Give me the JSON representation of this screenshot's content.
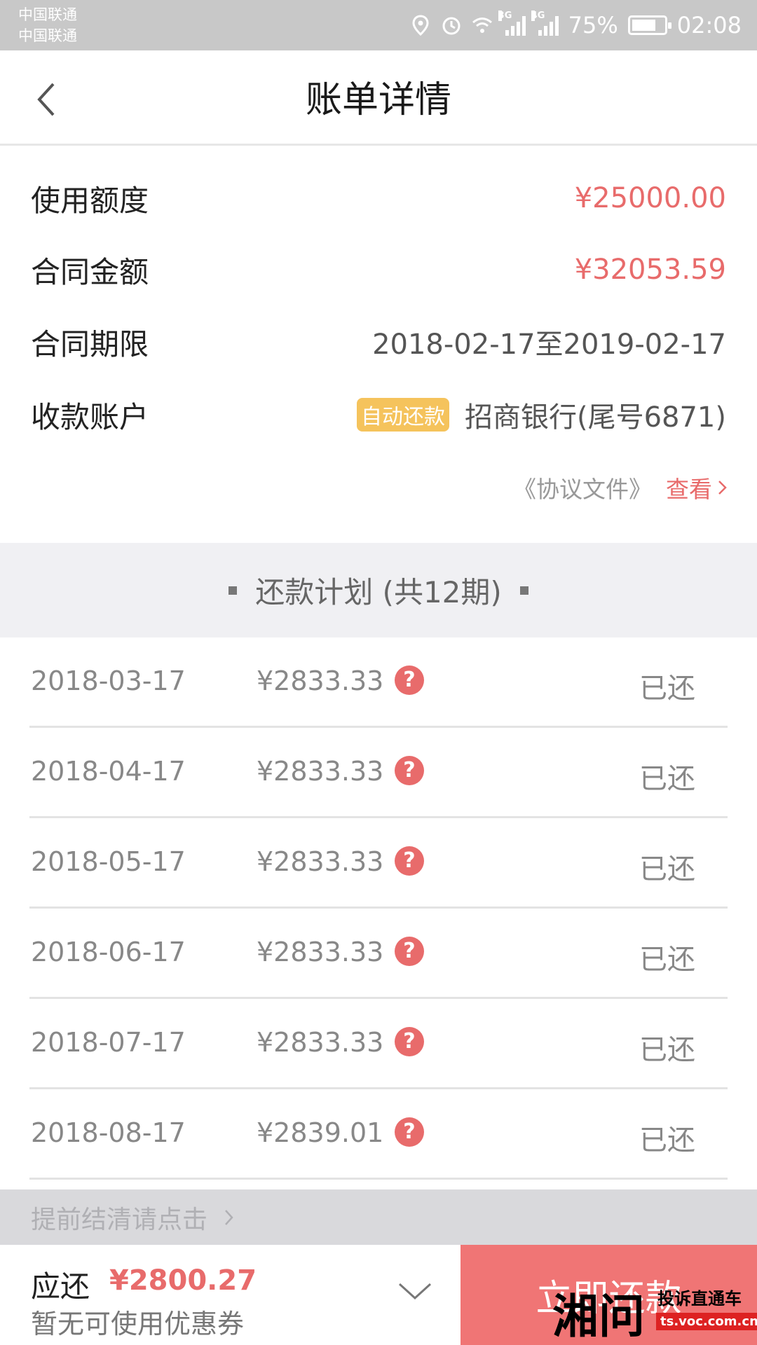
{
  "status_bar": {
    "carrier_1": "中国联通",
    "carrier_2": "中国联通",
    "network_1": "3G",
    "network_2": "4G",
    "battery": "75%",
    "battery_level": 0.75,
    "time": "02:08"
  },
  "header": {
    "title": "账单详情"
  },
  "info": {
    "credit_label": "使用额度",
    "credit_value": "¥25000.00",
    "contract_amount_label": "合同金额",
    "contract_amount_value": "¥32053.59",
    "term_label": "合同期限",
    "term_value": "2018-02-17至2019-02-17",
    "account_label": "收款账户",
    "auto_repay_badge": "自动还款",
    "account_value": "招商银行(尾号6871)",
    "agreement_label": "《协议文件》",
    "agreement_view": "查看"
  },
  "plan": {
    "title": "还款计划 (共12期)",
    "rows": [
      {
        "date": "2018-03-17",
        "amount": "¥2833.33",
        "status": "已还"
      },
      {
        "date": "2018-04-17",
        "amount": "¥2833.33",
        "status": "已还"
      },
      {
        "date": "2018-05-17",
        "amount": "¥2833.33",
        "status": "已还"
      },
      {
        "date": "2018-06-17",
        "amount": "¥2833.33",
        "status": "已还"
      },
      {
        "date": "2018-07-17",
        "amount": "¥2833.33",
        "status": "已还"
      },
      {
        "date": "2018-08-17",
        "amount": "¥2839.01",
        "status": "已还"
      }
    ]
  },
  "prepay": {
    "label": "提前结清请点击"
  },
  "bottom": {
    "due_label": "应还",
    "due_amount": "¥2800.27",
    "coupon_text": "暂无可使用优惠券",
    "pay_button": "立即还款"
  },
  "watermark": {
    "logo": "湘问",
    "text": "投诉直通车",
    "url": "ts.voc.com.cn"
  },
  "colors": {
    "accent_red": "#e86b6b",
    "badge_yellow": "#f5c35c",
    "pay_button": "#f07575"
  }
}
